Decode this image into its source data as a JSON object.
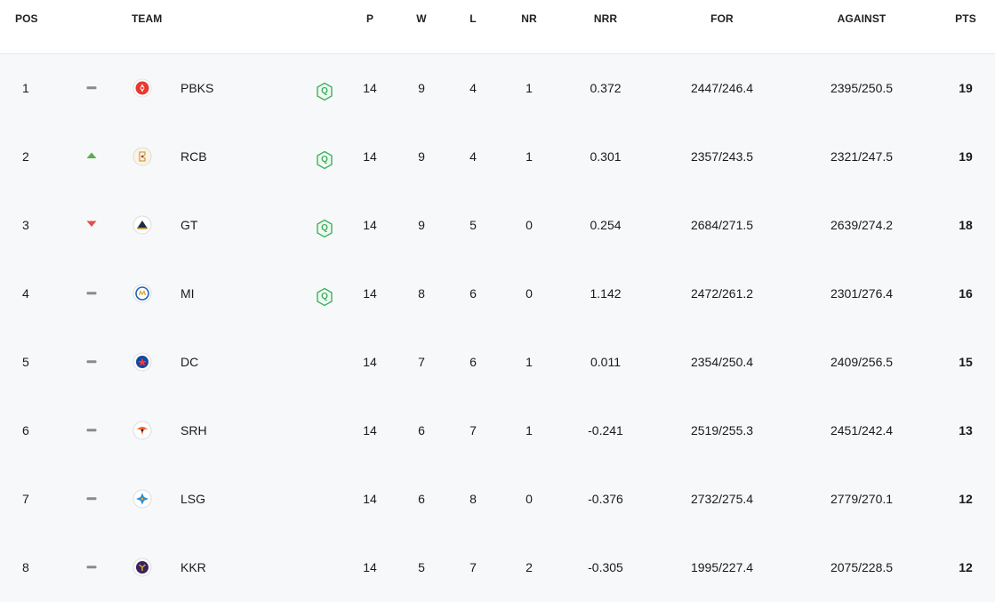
{
  "headers": {
    "pos": "POS",
    "team": "TEAM",
    "p": "P",
    "w": "W",
    "l": "L",
    "nr": "NR",
    "nrr": "NRR",
    "for": "FOR",
    "against": "AGAINST",
    "pts": "PTS"
  },
  "colors": {
    "up": "#5cae4a",
    "down": "#d9534f",
    "same": "#8a8a8a",
    "qualified": "#3fb05e"
  },
  "rows": [
    {
      "pos": "1",
      "trend": "same",
      "logo": "pbks-logo-icon",
      "team": "PBKS",
      "qualified": true,
      "q": "Q",
      "p": "14",
      "w": "9",
      "l": "4",
      "nr": "1",
      "nrr": "0.372",
      "for": "2447/246.4",
      "against": "2395/250.5",
      "pts": "19"
    },
    {
      "pos": "2",
      "trend": "up",
      "logo": "rcb-logo-icon",
      "team": "RCB",
      "qualified": true,
      "q": "Q",
      "p": "14",
      "w": "9",
      "l": "4",
      "nr": "1",
      "nrr": "0.301",
      "for": "2357/243.5",
      "against": "2321/247.5",
      "pts": "19"
    },
    {
      "pos": "3",
      "trend": "down",
      "logo": "gt-logo-icon",
      "team": "GT",
      "qualified": true,
      "q": "Q",
      "p": "14",
      "w": "9",
      "l": "5",
      "nr": "0",
      "nrr": "0.254",
      "for": "2684/271.5",
      "against": "2639/274.2",
      "pts": "18"
    },
    {
      "pos": "4",
      "trend": "same",
      "logo": "mi-logo-icon",
      "team": "MI",
      "qualified": true,
      "q": "Q",
      "p": "14",
      "w": "8",
      "l": "6",
      "nr": "0",
      "nrr": "1.142",
      "for": "2472/261.2",
      "against": "2301/276.4",
      "pts": "16"
    },
    {
      "pos": "5",
      "trend": "same",
      "logo": "dc-logo-icon",
      "team": "DC",
      "qualified": false,
      "p": "14",
      "w": "7",
      "l": "6",
      "nr": "1",
      "nrr": "0.011",
      "for": "2354/250.4",
      "against": "2409/256.5",
      "pts": "15"
    },
    {
      "pos": "6",
      "trend": "same",
      "logo": "srh-logo-icon",
      "team": "SRH",
      "qualified": false,
      "p": "14",
      "w": "6",
      "l": "7",
      "nr": "1",
      "nrr": "-0.241",
      "for": "2519/255.3",
      "against": "2451/242.4",
      "pts": "13"
    },
    {
      "pos": "7",
      "trend": "same",
      "logo": "lsg-logo-icon",
      "team": "LSG",
      "qualified": false,
      "p": "14",
      "w": "6",
      "l": "8",
      "nr": "0",
      "nrr": "-0.376",
      "for": "2732/275.4",
      "against": "2779/270.1",
      "pts": "12"
    },
    {
      "pos": "8",
      "trend": "same",
      "logo": "kkr-logo-icon",
      "team": "KKR",
      "qualified": false,
      "p": "14",
      "w": "5",
      "l": "7",
      "nr": "2",
      "nrr": "-0.305",
      "for": "1995/227.4",
      "against": "2075/228.5",
      "pts": "12"
    }
  ]
}
